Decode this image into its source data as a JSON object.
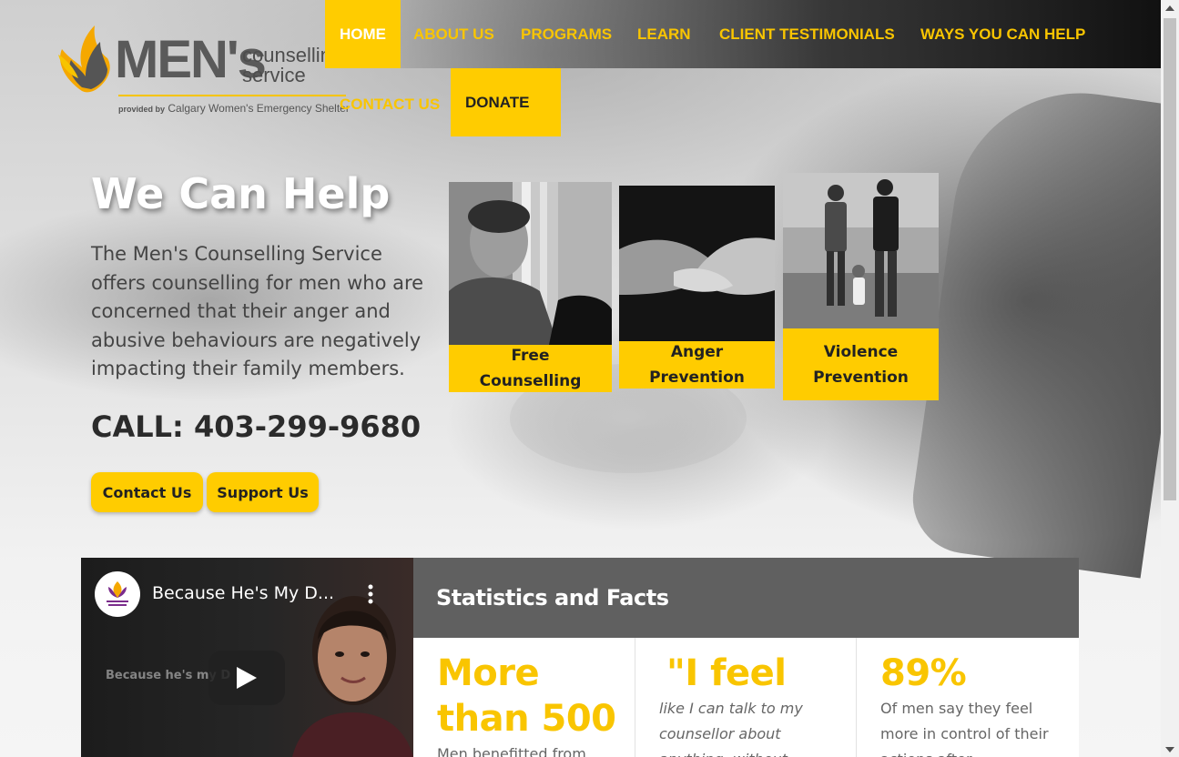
{
  "logo": {
    "brand": "MEN's",
    "line1": "counselling",
    "line2": "service",
    "provided_prefix": "provided by",
    "provided_org": "Calgary Women's Emergency Shelter"
  },
  "nav": {
    "home": "HOME",
    "about": "ABOUT US",
    "programs": "PROGRAMS",
    "learn": "LEARN",
    "testimonials": "CLIENT TESTIMONIALS",
    "ways": "WAYS YOU CAN HELP",
    "contact": "CONTACT US",
    "donate": "DONATE"
  },
  "hero": {
    "title": "We Can Help",
    "text": "The Men's Counselling Service offers counselling for men who are concerned that their anger and abusive behaviours are negatively impacting their family members.",
    "call": "CALL: 403-299-9680",
    "contact_button": "Contact Us",
    "support_button": "Support Us"
  },
  "programs": [
    {
      "label": "Free Counselling",
      "icon": "smiling-man-photo"
    },
    {
      "label": "Anger Prevention",
      "icon": "handshake-photo"
    },
    {
      "label": "Violence Prevention",
      "icon": "family-walking-photo"
    }
  ],
  "video": {
    "title": "Because He's My D...",
    "caption": "Because he's my D"
  },
  "stats": {
    "heading": "Statistics and Facts",
    "items": [
      {
        "big": "More than 500",
        "small": "Men benefitted from this"
      },
      {
        "big": "\"I feel",
        "small": "like I can talk to my counsellor about anything, without"
      },
      {
        "big": "89%",
        "small": "Of men say they feel more in control of their actions after"
      }
    ]
  },
  "colors": {
    "accent": "#ffcc00",
    "nav_text": "#f9c500",
    "stats_header": "#606060",
    "dark_text": "#222222"
  }
}
